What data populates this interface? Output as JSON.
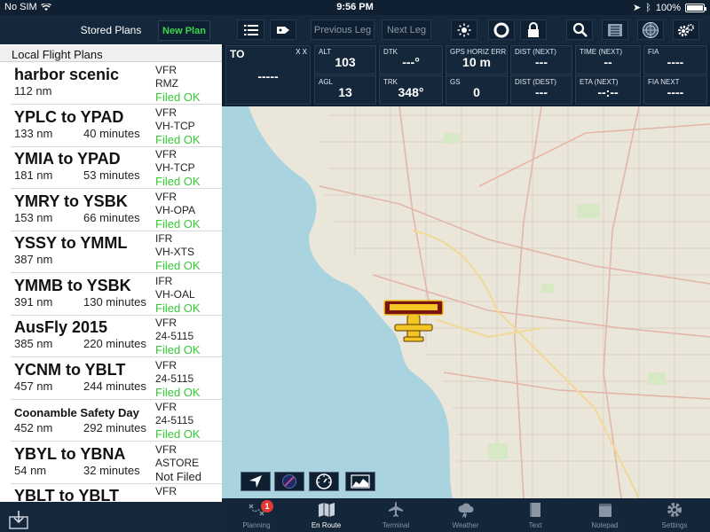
{
  "statusbar": {
    "carrier": "No SIM",
    "time": "9:56 PM",
    "battery_text": "100%",
    "battery_level": 1.0
  },
  "left_panel": {
    "header_title": "Stored Plans",
    "new_plan_label": "New Plan",
    "section_title": "Local Flight Plans",
    "plans": [
      {
        "name": "harbor scenic",
        "distance": "112 nm",
        "time": "",
        "rules": "VFR",
        "registration": "RMZ",
        "status": "Filed OK"
      },
      {
        "name": "YPLC to YPAD",
        "distance": "133 nm",
        "time": "40 minutes",
        "rules": "VFR",
        "registration": "VH-TCP",
        "status": "Filed OK"
      },
      {
        "name": "YMIA to YPAD",
        "distance": "181 nm",
        "time": "53 minutes",
        "rules": "VFR",
        "registration": "VH-TCP",
        "status": "Filed OK"
      },
      {
        "name": "YMRY to YSBK",
        "distance": "153 nm",
        "time": "66 minutes",
        "rules": "VFR",
        "registration": "VH-OPA",
        "status": "Filed OK"
      },
      {
        "name": "YSSY to YMML",
        "distance": "387 nm",
        "time": "",
        "rules": "IFR",
        "registration": "VH-XTS",
        "status": "Filed OK"
      },
      {
        "name": "YMMB to YSBK",
        "distance": "391 nm",
        "time": "130 minutes",
        "rules": "IFR",
        "registration": "VH-OAL",
        "status": "Filed OK"
      },
      {
        "name": "AusFly 2015",
        "distance": "385 nm",
        "time": "220 minutes",
        "rules": "VFR",
        "registration": "24-5115",
        "status": "Filed OK"
      },
      {
        "name": "YCNM to YBLT",
        "distance": "457 nm",
        "time": "244 minutes",
        "rules": "VFR",
        "registration": "24-5115",
        "status": "Filed OK"
      },
      {
        "name": "Coonamble Safety Day",
        "distance": "452 nm",
        "time": "292 minutes",
        "rules": "VFR",
        "registration": "24-5115",
        "status": "Filed OK"
      },
      {
        "name": "YBYL to YBNA",
        "distance": "54 nm",
        "time": "32 minutes",
        "rules": "VFR",
        "registration": "ASTORE",
        "status": "Not Filed"
      },
      {
        "name": "YBLT to YBLT",
        "distance": "",
        "time": "",
        "rules": "VFR",
        "registration": "",
        "status": ""
      }
    ]
  },
  "toolbar": {
    "previous_leg_label": "Previous Leg",
    "next_leg_label": "Next Leg"
  },
  "instruments": {
    "to": {
      "label": "TO",
      "xx": "X X",
      "value": "-----"
    },
    "cells": [
      {
        "key": "alt",
        "label": "ALT",
        "value": "103"
      },
      {
        "key": "dtk",
        "label": "DTK",
        "value": "---°"
      },
      {
        "key": "gps",
        "label": "GPS HORIZ ERR",
        "value": "10 m"
      },
      {
        "key": "dist_next",
        "label": "DIST (NEXT)",
        "value": "---"
      },
      {
        "key": "time_next",
        "label": "TIME (NEXT)",
        "value": "--"
      },
      {
        "key": "fia",
        "label": "FIA",
        "value": "----"
      },
      {
        "key": "agl",
        "label": "AGL",
        "value": "13"
      },
      {
        "key": "trk",
        "label": "TRK",
        "value": "348°"
      },
      {
        "key": "gs",
        "label": "GS",
        "value": "0"
      },
      {
        "key": "dist_dest",
        "label": "DIST (DEST)",
        "value": "---"
      },
      {
        "key": "eta_next",
        "label": "ETA (NEXT)",
        "value": "--:--"
      },
      {
        "key": "fia_next",
        "label": "FIA NEXT",
        "value": "----"
      }
    ]
  },
  "tabs": [
    {
      "id": "planning",
      "label": "Planning",
      "badge": "1",
      "icon": "planning-icon"
    },
    {
      "id": "enroute",
      "label": "En Route",
      "badge": "",
      "icon": "map-icon"
    },
    {
      "id": "terminal",
      "label": "Terminal",
      "badge": "",
      "icon": "airplane-icon"
    },
    {
      "id": "weather",
      "label": "Weather",
      "badge": "",
      "icon": "weather-icon"
    },
    {
      "id": "text",
      "label": "Text",
      "badge": "",
      "icon": "book-icon"
    },
    {
      "id": "notepad",
      "label": "Notepad",
      "badge": "",
      "icon": "notepad-icon"
    },
    {
      "id": "settings",
      "label": "Settings",
      "badge": "",
      "icon": "gear-icon"
    }
  ],
  "colors": {
    "filed_ok": "#33cc33",
    "new_plan": "#3ed64a",
    "toolbar_bg": "#14273b",
    "water": "#a9d3df"
  }
}
